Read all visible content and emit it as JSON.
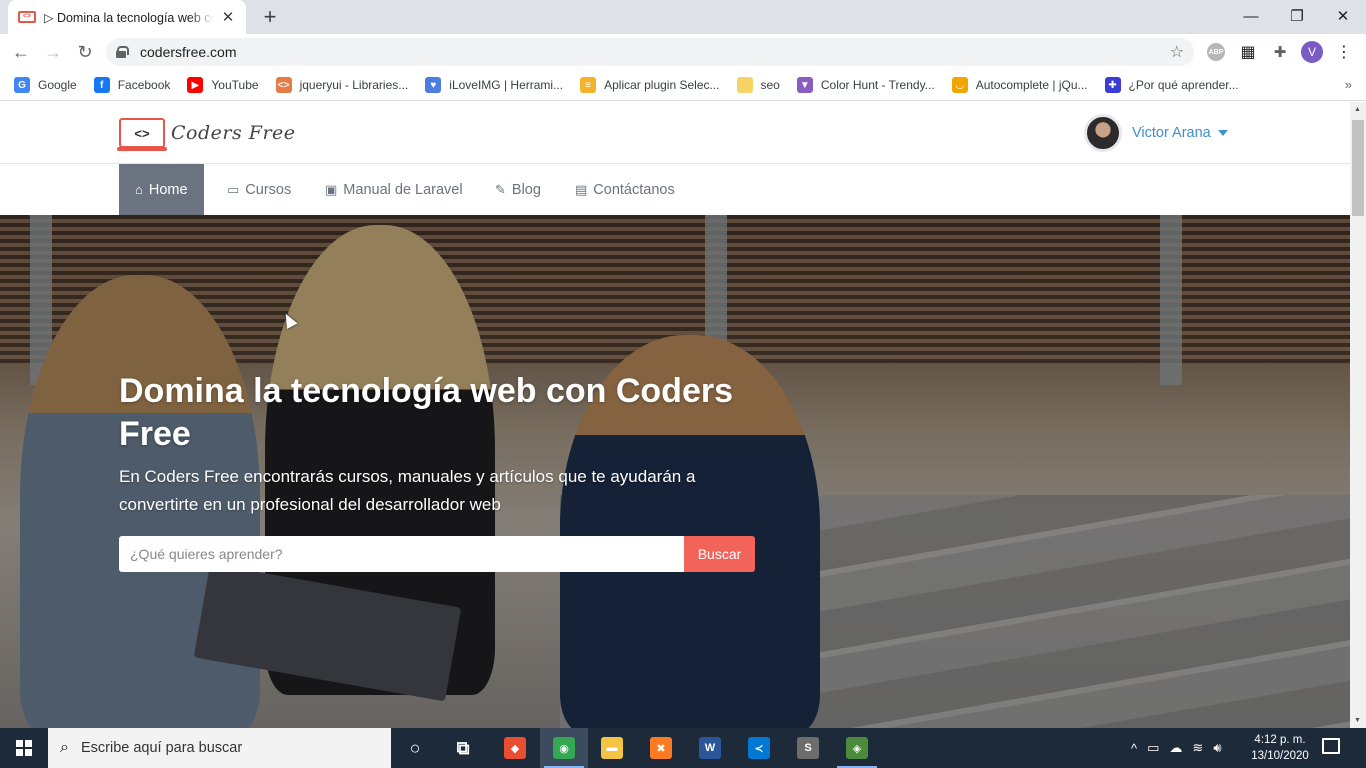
{
  "browser": {
    "tab_title": "▷ Domina la tecnología web con Coders Free",
    "tab_close": "✕",
    "new_tab": "+",
    "url": "codersfree.com",
    "win_controls": {
      "minimize": "—",
      "maximize": "❐",
      "close": "✕"
    },
    "profile_initial": "V",
    "ext_abp": "ABP",
    "bookmarks": [
      {
        "label": "Google",
        "icon": "google-icon",
        "color": "#4285f4",
        "glyph": "G"
      },
      {
        "label": "Facebook",
        "icon": "facebook-icon",
        "color": "#1877f2",
        "glyph": "f"
      },
      {
        "label": "YouTube",
        "icon": "youtube-icon",
        "color": "#ff0000",
        "glyph": "▶"
      },
      {
        "label": "jqueryui - Libraries...",
        "icon": "code-icon",
        "color": "#e77b48",
        "glyph": "<>"
      },
      {
        "label": "iLoveIMG | Herrami...",
        "icon": "heart-icon",
        "color": "#4c7ddf",
        "glyph": "♥"
      },
      {
        "label": "Aplicar plugin Selec...",
        "icon": "stackoverflow-icon",
        "color": "#f4b328",
        "glyph": "≡"
      },
      {
        "label": "seo",
        "icon": "folder-icon",
        "color": "#f6d365",
        "glyph": ""
      },
      {
        "label": "Color Hunt - Trendy...",
        "icon": "colorhunt-icon",
        "color": "#8a5cc0",
        "glyph": "▼"
      },
      {
        "label": "Autocomplete | jQu...",
        "icon": "shield-icon",
        "color": "#f0a500",
        "glyph": "◡"
      },
      {
        "label": "¿Por qué aprender...",
        "icon": "square-icon",
        "color": "#3b3bd6",
        "glyph": "✚"
      }
    ],
    "bookmarks_more": "»"
  },
  "site": {
    "logo_mark": "<>",
    "logo_text": "Coders Free",
    "user_name": "Victor Arana",
    "nav": [
      {
        "label": "Home",
        "glyph": "⌂",
        "active": true
      },
      {
        "label": "Cursos",
        "glyph": "▭"
      },
      {
        "label": "Manual de Laravel",
        "glyph": "▣"
      },
      {
        "label": "Blog",
        "glyph": "✎"
      },
      {
        "label": "Contáctanos",
        "glyph": "▤"
      }
    ],
    "hero": {
      "title": "Domina la tecnología web con Coders Free",
      "subtitle": "En Coders Free encontrarás cursos, manuales y artículos que te ayudarán a convertirte en un profesional del desarrollador web",
      "search_placeholder": "¿Qué quieres aprender?",
      "search_button": "Buscar"
    }
  },
  "taskbar": {
    "search_placeholder": "Escribe aquí para buscar",
    "apps": [
      {
        "name": "cortana",
        "glyph": "○",
        "color": "transparent"
      },
      {
        "name": "task-view",
        "glyph": "⧉",
        "color": "transparent"
      },
      {
        "name": "git",
        "glyph": "◆",
        "color": "#e94e31"
      },
      {
        "name": "chrome",
        "glyph": "◉",
        "color": "#34a853"
      },
      {
        "name": "file-explorer",
        "glyph": "▬",
        "color": "#f4c542"
      },
      {
        "name": "xampp",
        "glyph": "✖",
        "color": "#fb7a24"
      },
      {
        "name": "word",
        "glyph": "W",
        "color": "#2b579a"
      },
      {
        "name": "vscode",
        "glyph": "≺",
        "color": "#0078d4"
      },
      {
        "name": "sublime",
        "glyph": "S",
        "color": "#6d6d6d"
      },
      {
        "name": "app-extra",
        "glyph": "◈",
        "color": "#4b8b3b"
      }
    ],
    "tray_icons": [
      "^",
      "▭",
      "☁",
      "≋",
      "🔊︎"
    ],
    "time": "4:12 p. m.",
    "date": "13/10/2020"
  },
  "colors": {
    "accent_blue": "#3f8fd1",
    "search_button": "#f2645a",
    "nav_active": "#6b7280"
  }
}
